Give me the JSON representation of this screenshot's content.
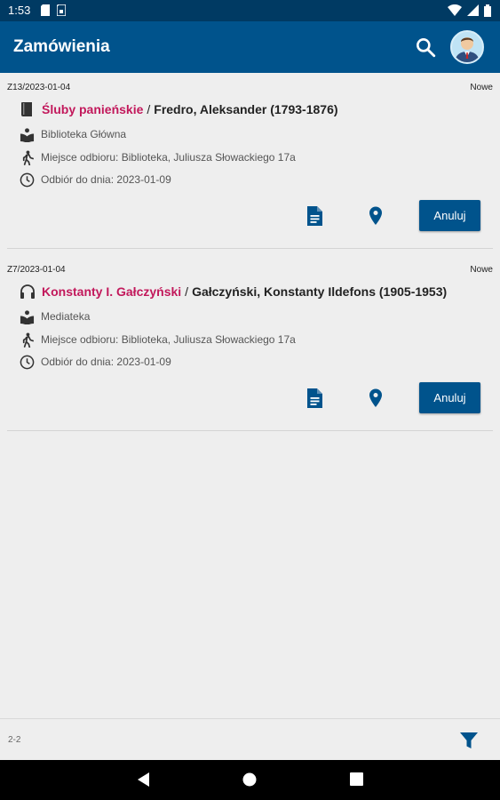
{
  "status_bar": {
    "time": "1:53",
    "icons": [
      "sd-card-icon",
      "sim-icon",
      "wifi-icon",
      "signal-icon",
      "battery-icon"
    ]
  },
  "app_bar": {
    "title": "Zamówienia",
    "icons": [
      "search-icon",
      "avatar"
    ]
  },
  "colors": {
    "primary": "#00538c",
    "status_bar": "#003a63",
    "title_accent": "#c2185b",
    "background": "#eeeeee"
  },
  "orders": [
    {
      "id": "Z13/2023-01-04",
      "status": "Nowe",
      "media_icon": "book-icon",
      "title": "Śluby panieńskie",
      "separator": "/",
      "author": "Fredro, Aleksander (1793-1876)",
      "library": "Biblioteka Główna",
      "pickup_place": "Miejsce odbioru: Biblioteka, Juliusza Słowackiego 17a",
      "pickup_deadline": "Odbiór do dnia: 2023-01-09",
      "cancel_label": "Anuluj"
    },
    {
      "id": "Z7/2023-01-04",
      "status": "Nowe",
      "media_icon": "headphones-icon",
      "title": "Konstanty I. Gałczyński",
      "separator": "/",
      "author": "Gałczyński, Konstanty Ildefons (1905-1953)",
      "library": "Mediateka",
      "pickup_place": "Miejsce odbioru: Biblioteka, Juliusza Słowackiego 17a",
      "pickup_deadline": "Odbiór do dnia: 2023-01-09",
      "cancel_label": "Anuluj"
    }
  ],
  "footer": {
    "page_count": "2-2",
    "filter_icon": "filter-icon"
  },
  "nav_bar": {
    "buttons": [
      "back-icon",
      "home-icon",
      "recents-icon"
    ]
  }
}
